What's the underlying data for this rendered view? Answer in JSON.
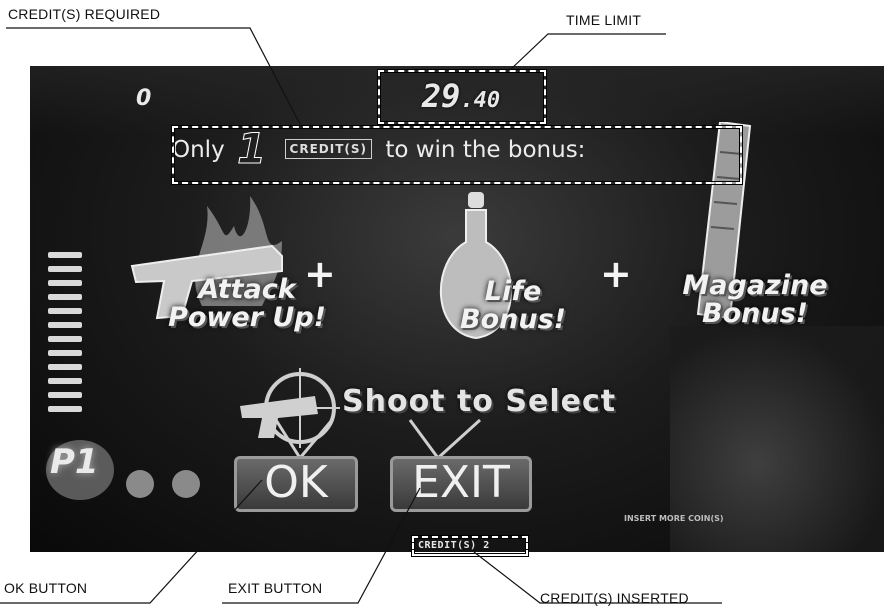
{
  "callouts": {
    "credits_required": "CREDIT(S) REQUIRED",
    "time_limit": "TIME LIMIT",
    "ok_button": "OK BUTTON",
    "exit_button": "EXIT BUTTON",
    "credits_inserted": "CREDIT(S) INSERTED"
  },
  "game": {
    "score": "0",
    "timer_main": "29",
    "timer_decimal": ".40",
    "message_prefix": "Only",
    "message_credits_number": "1",
    "message_credits_word": "CREDIT(S)",
    "message_suffix": "to win the bonus:",
    "bonus_1_line1": "Attack",
    "bonus_1_line2": "Power Up!",
    "bonus_2_line1": "Life",
    "bonus_2_line2": "Bonus!",
    "bonus_3_line1": "Magazine",
    "bonus_3_line2": "Bonus!",
    "plus_sign": "+",
    "shoot_to_select": "Shoot to Select",
    "ok_label": "OK",
    "exit_label": "EXIT",
    "credits_inserted_value": "CREDIT(S) 2",
    "insert_coin_text": "INSERT MORE COIN(S)",
    "player_label": "P1"
  }
}
